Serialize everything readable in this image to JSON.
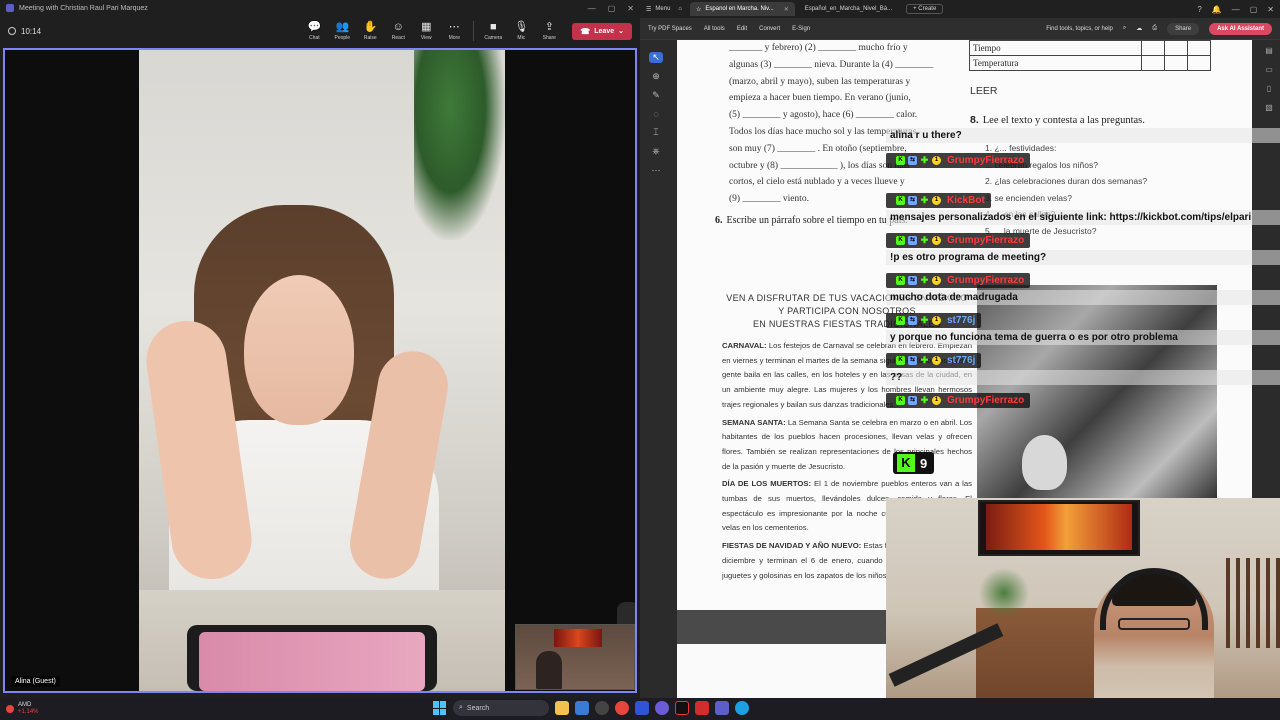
{
  "teams": {
    "window_title": "Meeting with Christian Raul Pari Marquez",
    "timer": "10:14",
    "tools": [
      {
        "label": "Chat",
        "icon": "chat-icon",
        "glyph": "💬"
      },
      {
        "label": "People",
        "icon": "people-icon",
        "glyph": "👥"
      },
      {
        "label": "Raise",
        "icon": "raise-hand-icon",
        "glyph": "✋"
      },
      {
        "label": "React",
        "icon": "react-icon",
        "glyph": "☺"
      },
      {
        "label": "View",
        "icon": "view-icon",
        "glyph": "▦"
      },
      {
        "label": "More",
        "icon": "more-icon",
        "glyph": "⋯"
      }
    ],
    "camera_label": "Camera",
    "mic_label": "Mic",
    "share_label": "Share",
    "leave_label": "Leave",
    "guest_label": "Alina (Guest)"
  },
  "edge": {
    "menu_label": "Menu",
    "tabs": [
      {
        "label": "Espanol en Marcha. Niv...",
        "active": true
      },
      {
        "label": "Español_en_Marcha_Nivel_Bá...",
        "active": false
      }
    ],
    "create_label": "+ Create",
    "toolbar": {
      "try_pdf": "Try PDF Spaces",
      "all_tools": "All tools",
      "edit": "Edit",
      "convert": "Convert",
      "esign": "E-Sign",
      "find": "Find tools, topics, or help",
      "share": "Share",
      "assistant": "Ask AI Assistant"
    }
  },
  "pdf": {
    "paragraph_lines": [
      "_______ y febrero) (2) ________ mucho frío y",
      "algunas (3) ________ nieva. Durante la (4) ________",
      "(marzo, abril y mayo), suben las temperaturas y",
      "empieza a hacer buen tiempo. En verano (junio,",
      "(5) ________ y agosto), hace (6) ________ calor.",
      "Todos los días hace mucho sol y las temperaturas",
      "son muy (7) ________ . En otoño (septiembre,",
      "octubre y (8) ____________ ), los días son más",
      "cortos, el cielo está nublado y a veces llueve y",
      "(9) ________ viento."
    ],
    "ex6_number": "6.",
    "ex6_text": "Escribe un párrafo sobre el tiempo en tu país.",
    "table_rows": [
      "Tiempo",
      "Temperatura"
    ],
    "leer": "LEER",
    "ex8_number": "8.",
    "ex8_text": "Lee el texto y contesta a las preguntas.",
    "questions": [
      "1. ¿... festividades:",
      "   ... celebran regalos los niños?",
      "2. ¿las celebraciones duran dos semanas?",
      "3. se encienden velas?",
      "4. ... en las calles?",
      "5. ... la muerte de Jesucristo?"
    ],
    "article_heading": [
      "VEN A DISFRUTAR DE TUS VACACIONES EN MÉXICO",
      "Y PARTICIPA CON NOSOTROS",
      "EN NUESTRAS FIESTAS TRADICIONALES"
    ],
    "article_paragraphs": [
      {
        "lead": "CARNAVAL:",
        "text": "Los festejos de Carnaval se celebran en febrero. Empiezan en viernes y terminan el martes de la semana siguiente. Todos los días la gente baila en las calles, en los hoteles y en las casas de la ciudad, en un ambiente muy alegre. Las mujeres y los hombres llevan hermosos trajes regionales y bailan sus danzas tradicionales."
      },
      {
        "lead": "SEMANA SANTA:",
        "text": "La Semana Santa se celebra en marzo o en abril. Los habitantes de los pueblos hacen procesiones, llevan velas y ofrecen flores. También se realizan representaciones de los principales hechos de la pasión y muerte de Jesucristo."
      },
      {
        "lead": "DÍA DE LOS MUERTOS:",
        "text": "El 1 de noviembre pueblos enteros van a las tumbas de sus muertos, llevándoles dulces, comida y flores. El espectáculo es impresionante por la noche cuando se encienden las velas en los cementerios."
      },
      {
        "lead": "FIESTAS DE NAVIDAD Y AÑO NUEVO:",
        "text": "Estas fiestas empiezan el 16 de diciembre y terminan el 6 de enero, cuando los Reyes Magos dejan juguetes y golosinas en los zapatos de los niños."
      }
    ]
  },
  "chat": {
    "messages": [
      {
        "user": "",
        "user_color": "#53fc18",
        "text": "alina r u there?"
      },
      {
        "user": "GrumpyFierrazo",
        "user_color": "#ff3b3b",
        "text": ""
      },
      {
        "user": "KickBot",
        "user_color": "#ff3b3b",
        "text": "mensajes personalizados en el siguiente link: https://kickbot.com/tips/elpari"
      },
      {
        "user": "GrumpyFierrazo",
        "user_color": "#ff3b3b",
        "text": "!p es otro programa de meeting?"
      },
      {
        "user": "GrumpyFierrazo",
        "user_color": "#ff3b3b",
        "text": "mucho dota de madrugada"
      },
      {
        "user": "st776j",
        "user_color": "#6ea7ff",
        "text": "y porque no funciona tema de guerra o es por otro problema"
      },
      {
        "user": "st776j",
        "user_color": "#6ea7ff",
        "text": "??"
      },
      {
        "user": "GrumpyFierrazo",
        "user_color": "#ff3b3b",
        "text": ""
      }
    ],
    "kick_count": "9",
    "kick_letter": "K"
  },
  "taskbar": {
    "stock_name": "AMD",
    "stock_change": "+1.14%",
    "search_placeholder": "Search"
  }
}
